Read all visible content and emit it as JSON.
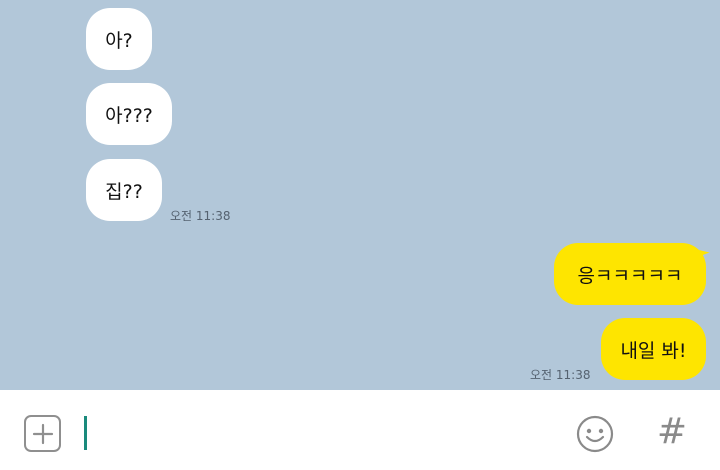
{
  "messages": {
    "incoming": [
      {
        "text": "아?"
      },
      {
        "text": "아???"
      },
      {
        "text": "집??"
      }
    ],
    "incoming_time": "오전 11:38",
    "outgoing": [
      {
        "text": "응ㅋㅋㅋㅋㅋ"
      },
      {
        "text": "내일 봐!"
      }
    ],
    "outgoing_time": "오전 11:38"
  },
  "input_bar": {
    "plus_icon": "plus-square-icon",
    "emoji_icon": "smiley-icon",
    "hash_label": "#",
    "input_value": ""
  },
  "colors": {
    "chat_background": "#b2c7d9",
    "incoming_bubble": "#ffffff",
    "outgoing_bubble": "#fee500",
    "caret": "#1a8a7c"
  }
}
